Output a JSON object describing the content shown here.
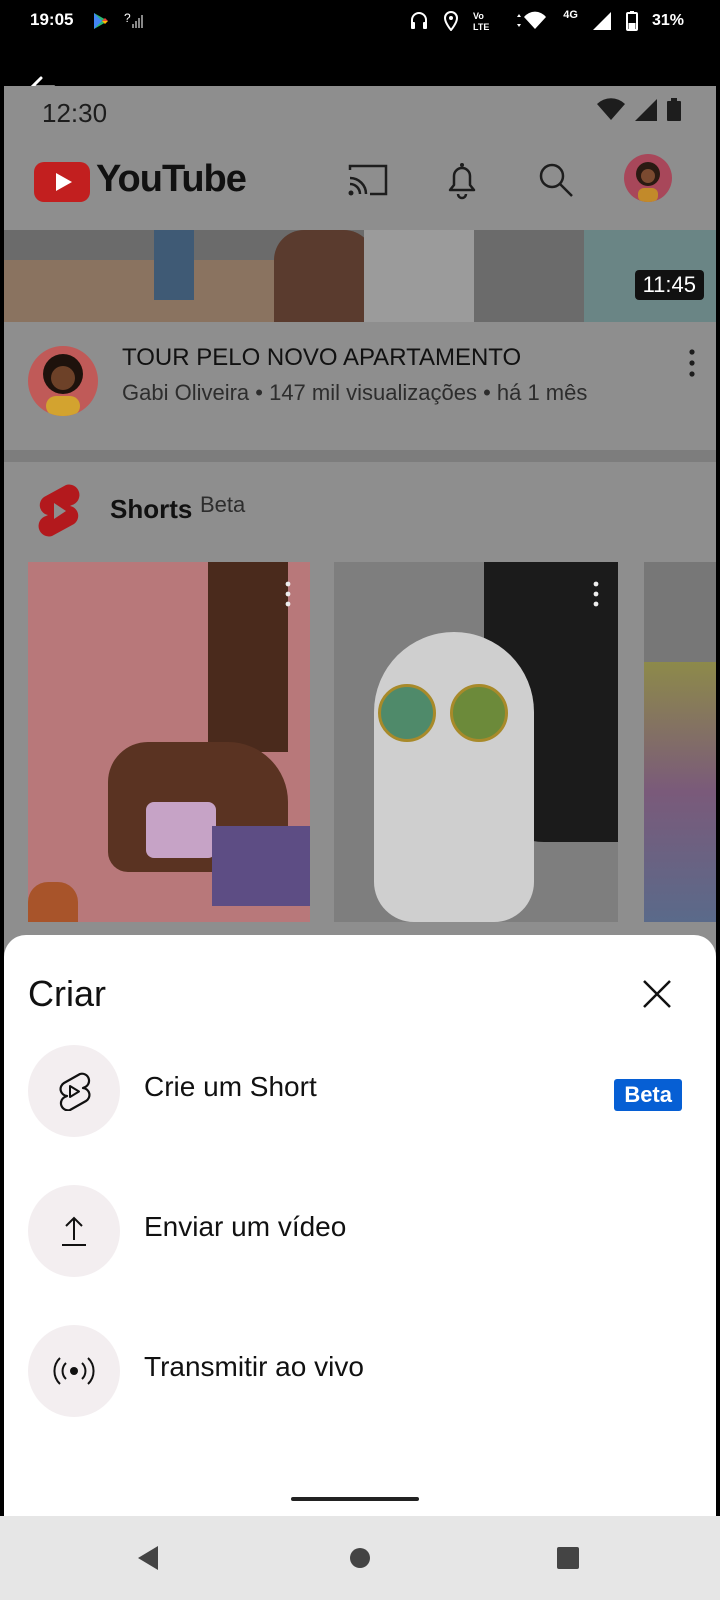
{
  "system_status": {
    "time": "19:05",
    "battery": "31%",
    "network": "4G"
  },
  "recorded_screen": {
    "status_time": "12:30",
    "header": {
      "logo_text": "YouTube"
    },
    "video": {
      "duration": "11:45",
      "title": "TOUR PELO NOVO APARTAMENTO",
      "meta": "Gabi Oliveira • 147 mil visualizações • há 1 mês"
    },
    "shorts_section": {
      "title": "Shorts",
      "badge": "Beta"
    }
  },
  "create_sheet": {
    "title": "Criar",
    "options": [
      {
        "label": "Crie um Short",
        "icon": "shorts-create-icon",
        "badge": "Beta"
      },
      {
        "label": "Enviar um vídeo",
        "icon": "upload-icon"
      },
      {
        "label": "Transmitir ao vivo",
        "icon": "live-broadcast-icon"
      }
    ]
  },
  "colors": {
    "accent": "#065fd4",
    "youtube_red": "#ff0000",
    "dim_overlay": "#8e8e8e"
  }
}
